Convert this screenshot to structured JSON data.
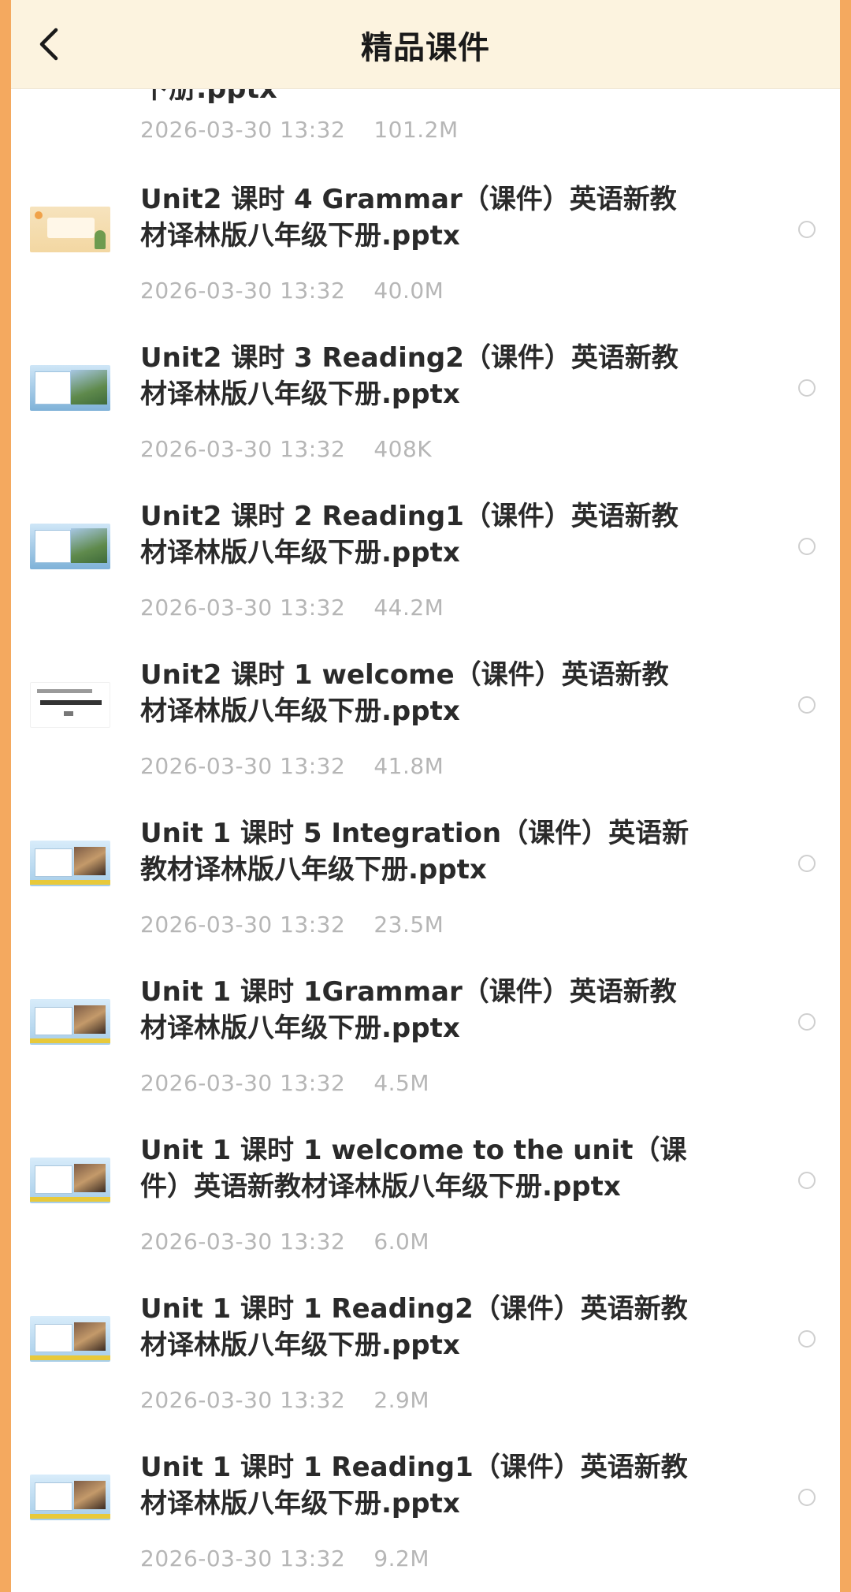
{
  "header": {
    "title": "精品课件",
    "back_icon": "chevron-left-icon"
  },
  "partial_item": {
    "name_tail": "下册.pptx",
    "date": "2026-03-30 13:32",
    "size": "101.2M"
  },
  "files": [
    {
      "name": "Unit2 课时 4 Grammar（课件）英语新教材译林版八年级下册.pptx",
      "date": "2026-03-30 13:32",
      "size": "40.0M",
      "thumb": "grammar"
    },
    {
      "name": "Unit2 课时 3 Reading2（课件）英语新教材译林版八年级下册.pptx",
      "date": "2026-03-30 13:32",
      "size": "408K",
      "thumb": "blue"
    },
    {
      "name": "Unit2 课时 2 Reading1（课件）英语新教材译林版八年级下册.pptx",
      "date": "2026-03-30 13:32",
      "size": "44.2M",
      "thumb": "blue"
    },
    {
      "name": "Unit2 课时 1 welcome（课件）英语新教材译林版八年级下册.pptx",
      "date": "2026-03-30 13:32",
      "size": "41.8M",
      "thumb": "white"
    },
    {
      "name": "Unit 1 课时 5 Integration（课件）英语新教材译林版八年级下册.pptx",
      "date": "2026-03-30 13:32",
      "size": "23.5M",
      "thumb": "unit1"
    },
    {
      "name": "Unit 1 课时 1Grammar（课件）英语新教材译林版八年级下册.pptx",
      "date": "2026-03-30 13:32",
      "size": "4.5M",
      "thumb": "unit1"
    },
    {
      "name": "Unit 1 课时 1 welcome to the unit（课件）英语新教材译林版八年级下册.pptx",
      "date": "2026-03-30 13:32",
      "size": "6.0M",
      "thumb": "unit1"
    },
    {
      "name": "Unit 1 课时 1 Reading2（课件）英语新教材译林版八年级下册.pptx",
      "date": "2026-03-30 13:32",
      "size": "2.9M",
      "thumb": "unit1"
    },
    {
      "name": "Unit 1 课时 1 Reading1（课件）英语新教材译林版八年级下册.pptx",
      "date": "2026-03-30 13:32",
      "size": "9.2M",
      "thumb": "unit1"
    }
  ]
}
